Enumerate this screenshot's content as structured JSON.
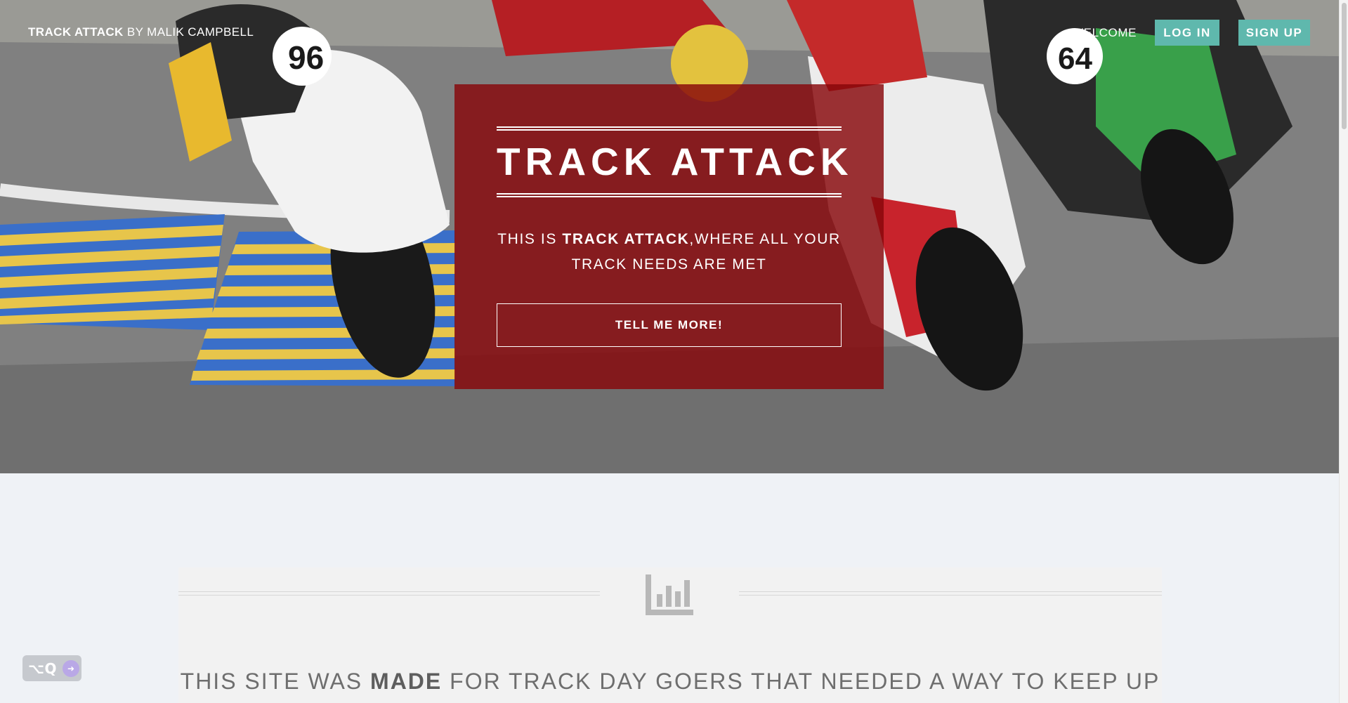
{
  "nav": {
    "brand_bold": "TRACK ATTACK",
    "brand_rest": " BY MALIK CAMPBELL",
    "welcome": "WELCOME",
    "login": "LOG IN",
    "signup": "SIGN UP"
  },
  "hero": {
    "title": "TRACK ATTACK",
    "desc_prefix": "THIS IS ",
    "desc_bold": "TRACK ATTACK",
    "desc_suffix": ",WHERE ALL YOUR TRACK NEEDS ARE MET",
    "cta": "TELL ME MORE!"
  },
  "section": {
    "icon": "bar-chart-icon",
    "text_prefix": "THIS SITE WAS ",
    "text_bold": "MADE",
    "text_suffix": " FOR TRACK DAY GOERS THAT NEEDED A WAY TO KEEP UP"
  },
  "widget": {
    "shortcut": "⌥Q"
  },
  "colors": {
    "accent": "#5fb8ad",
    "card": "#87060a",
    "page_bg": "#eff2f6"
  }
}
